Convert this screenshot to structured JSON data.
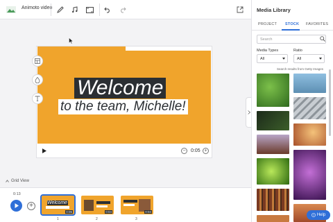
{
  "toolbar": {
    "project_name": "Animoto video"
  },
  "canvas": {
    "title": "Welcome",
    "subtitle": "to the team, Michelle!",
    "duration": "0:05"
  },
  "timeline": {
    "grid_view_label": "Grid View",
    "current_time": "0:13",
    "scenes": [
      {
        "number": "1",
        "duration": "0:05"
      },
      {
        "number": "2",
        "duration": "0:04"
      },
      {
        "number": "3",
        "duration": "0:04"
      }
    ],
    "thumb1_text": "Welcome"
  },
  "panel": {
    "title": "Media Library",
    "tabs": [
      "PROJECT",
      "STOCK",
      "FAVORITES"
    ],
    "active_tab": "STOCK",
    "search_placeholder": "Search",
    "media_types_label": "Media Types",
    "media_types_value": "All",
    "ratio_label": "Ratio",
    "ratio_value": "All",
    "results_note": "Search results from Getty Images"
  },
  "help_label": "Help",
  "colors": {
    "accent": "#2f6fd8",
    "scene_bg": "#f0a42c",
    "title_bg": "#2b2f33"
  }
}
